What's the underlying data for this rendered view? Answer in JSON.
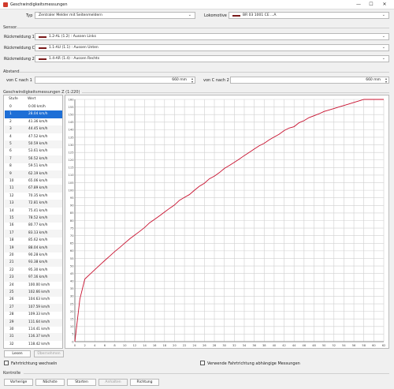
{
  "window": {
    "title": "Geschwindigkeitsmessungen",
    "minimize_label": "—",
    "maximize_label": "☐",
    "close_label": "✕"
  },
  "typ": {
    "label": "Typ",
    "value": "Zentraler Melder mit Seitenmeldern"
  },
  "lokomotive": {
    "label": "Lokomotive",
    "value": "BR 03 1001 CE ...A"
  },
  "sensor": {
    "group_label": "Sensor",
    "rueckmeldungen": [
      {
        "label": "Rückmeldung 1",
        "value": "1.2-AL (1.2) : Aussen Links"
      },
      {
        "label": "Rückmeldung C",
        "value": "1.1-AU (1.1) : Aussen Unten"
      },
      {
        "label": "Rückmeldung 2",
        "value": "1.4-AR (1.4) : Aussen Rechts"
      }
    ]
  },
  "abstand": {
    "group_label": "Abstand",
    "von1": {
      "label": "von C nach 1",
      "value": "660 mm"
    },
    "von2": {
      "label": "von C nach 2",
      "value": "660 mm"
    }
  },
  "messungen": {
    "group_label": "Geschwindigkeitsmessungen Z (1:220)",
    "columns": [
      "Stufe",
      "Wert"
    ],
    "rows": [
      [
        "0",
        "0.00 km/h"
      ],
      [
        "1",
        "28.04 km/h"
      ],
      [
        "2",
        "41.36 km/h"
      ],
      [
        "3",
        "44.45 km/h"
      ],
      [
        "4",
        "47.52 km/h"
      ],
      [
        "5",
        "50.59 km/h"
      ],
      [
        "6",
        "53.61 km/h"
      ],
      [
        "7",
        "56.52 km/h"
      ],
      [
        "8",
        "59.51 km/h"
      ],
      [
        "9",
        "62.19 km/h"
      ],
      [
        "10",
        "65.06 km/h"
      ],
      [
        "11",
        "67.89 km/h"
      ],
      [
        "12",
        "70.35 km/h"
      ],
      [
        "13",
        "72.81 km/h"
      ],
      [
        "14",
        "75.41 km/h"
      ],
      [
        "15",
        "78.52 km/h"
      ],
      [
        "16",
        "80.77 km/h"
      ],
      [
        "17",
        "83.13 km/h"
      ],
      [
        "18",
        "85.62 km/h"
      ],
      [
        "19",
        "88.04 km/h"
      ],
      [
        "20",
        "90.28 km/h"
      ],
      [
        "21",
        "93.38 km/h"
      ],
      [
        "22",
        "95.30 km/h"
      ],
      [
        "23",
        "97.16 km/h"
      ],
      [
        "24",
        "100.00 km/h"
      ],
      [
        "25",
        "102.66 km/h"
      ],
      [
        "26",
        "104.63 km/h"
      ],
      [
        "27",
        "107.59 km/h"
      ],
      [
        "28",
        "109.33 km/h"
      ],
      [
        "29",
        "111.64 km/h"
      ],
      [
        "30",
        "114.41 km/h"
      ],
      [
        "31",
        "116.37 km/h"
      ],
      [
        "32",
        "118.42 km/h"
      ]
    ],
    "selected_row": 1,
    "lesen_button": "Lesen",
    "uebernehmen_button": "Übernehmen"
  },
  "chart_data": {
    "type": "line",
    "x": [
      0,
      1,
      2,
      3,
      4,
      5,
      6,
      7,
      8,
      9,
      10,
      11,
      12,
      13,
      14,
      15,
      16,
      17,
      18,
      19,
      20,
      21,
      22,
      23,
      24,
      25,
      26,
      27,
      28,
      29,
      30,
      31,
      32,
      33,
      34,
      35,
      36,
      37,
      38,
      39,
      40,
      41,
      42,
      43,
      44,
      45,
      46,
      47,
      48,
      49,
      50,
      51,
      52,
      53,
      54,
      55,
      56,
      57,
      58,
      59,
      60,
      61,
      62
    ],
    "values": [
      0,
      28.04,
      41.36,
      44.45,
      47.52,
      50.59,
      53.61,
      56.52,
      59.51,
      62.19,
      65.06,
      67.89,
      70.35,
      72.81,
      75.41,
      78.52,
      80.77,
      83.13,
      85.62,
      88.04,
      90.28,
      93.38,
      95.3,
      97.16,
      100.0,
      102.66,
      104.63,
      107.59,
      109.33,
      111.64,
      114.41,
      116.37,
      118.42,
      120.6,
      122.9,
      125.0,
      127.2,
      129.4,
      131.0,
      133.3,
      135.2,
      137.0,
      139.4,
      141.1,
      142.0,
      144.6,
      146.0,
      148.0,
      149.2,
      150.5,
      152,
      153,
      154,
      155,
      156,
      157,
      158,
      159,
      160,
      160,
      160,
      160,
      160
    ],
    "xlim": [
      0,
      62
    ],
    "ylim": [
      0,
      160
    ],
    "xticks": [
      0,
      2,
      4,
      6,
      8,
      10,
      12,
      14,
      16,
      18,
      20,
      22,
      24,
      26,
      28,
      30,
      32,
      34,
      36,
      38,
      40,
      42,
      44,
      46,
      48,
      50,
      52,
      54,
      56,
      58,
      60,
      62
    ],
    "yticks": [
      0,
      5,
      10,
      15,
      20,
      25,
      30,
      35,
      40,
      45,
      50,
      55,
      60,
      65,
      70,
      75,
      80,
      85,
      90,
      95,
      100,
      105,
      110,
      115,
      120,
      125,
      130,
      135,
      140,
      145,
      150,
      155,
      160
    ],
    "grid": true,
    "line_color": "#c8102e"
  },
  "fahrtrichtung_wechseln": "Fahrtrichtung wechseln",
  "verwende_fahrtrichtung": "Verwende Fahrtrichtung abhängige Messungen",
  "kontrolle": {
    "group_label": "Kontrolle",
    "buttons": [
      {
        "label": "Vorherige",
        "enabled": true
      },
      {
        "label": "Nächste",
        "enabled": true
      },
      {
        "label": "Starten",
        "enabled": true
      },
      {
        "label": "Anhalten",
        "enabled": false
      },
      {
        "label": "Richtung",
        "enabled": true
      }
    ]
  }
}
